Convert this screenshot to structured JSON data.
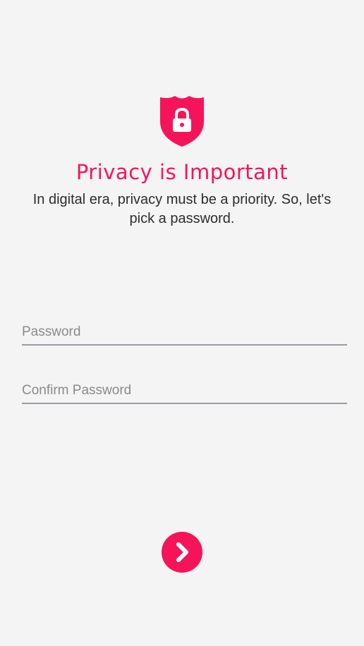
{
  "header": {
    "icon": "shield-lock-icon",
    "title": "Privacy is Important",
    "subtitle": "In digital era, privacy must be a priority. So, let's pick a password."
  },
  "form": {
    "password_placeholder": "Password",
    "password_value": "",
    "confirm_placeholder": "Confirm Password",
    "confirm_value": ""
  },
  "actions": {
    "next_icon": "chevron-right-icon"
  },
  "colors": {
    "accent": "#f5145a",
    "background": "#f4f4f4",
    "text": "#2d2d2d",
    "underline": "#9a9aa6"
  }
}
